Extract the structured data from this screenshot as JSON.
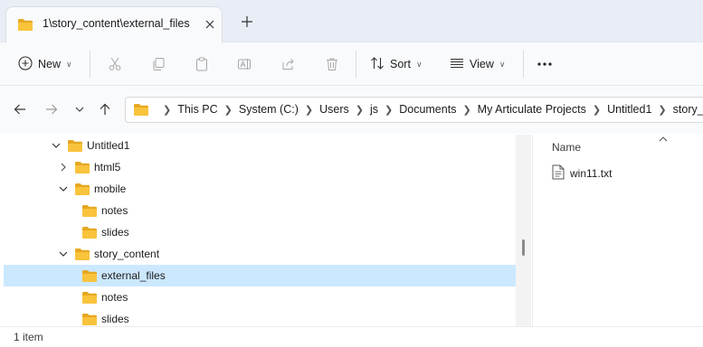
{
  "tab": {
    "title": "1\\story_content\\external_files",
    "close_icon": "close-icon",
    "new_tab_icon": "plus-icon"
  },
  "toolbar": {
    "new_label": "New",
    "sort_label": "Sort",
    "view_label": "View",
    "more_icon": "ellipsis-icon"
  },
  "breadcrumb": [
    "This PC",
    "System (C:)",
    "Users",
    "js",
    "Documents",
    "My Articulate Projects",
    "Untitled1",
    "story_content"
  ],
  "tree": {
    "items": [
      {
        "label": "Untitled1",
        "expanded": true
      },
      {
        "label": "html5",
        "expanded": false
      },
      {
        "label": "mobile",
        "expanded": true
      },
      {
        "label": "notes"
      },
      {
        "label": "slides"
      },
      {
        "label": "story_content",
        "expanded": true
      },
      {
        "label": "external_files",
        "selected": true
      },
      {
        "label": "notes"
      },
      {
        "label": "slides"
      }
    ]
  },
  "files": {
    "column_name": "Name",
    "items": [
      {
        "name": "win11.txt",
        "icon": "text-file-icon"
      }
    ]
  },
  "status": {
    "item_count": "1 item"
  },
  "colors": {
    "selection": "#cce8ff",
    "folder": "#f9c33c",
    "title_bar": "#e9eef6"
  }
}
